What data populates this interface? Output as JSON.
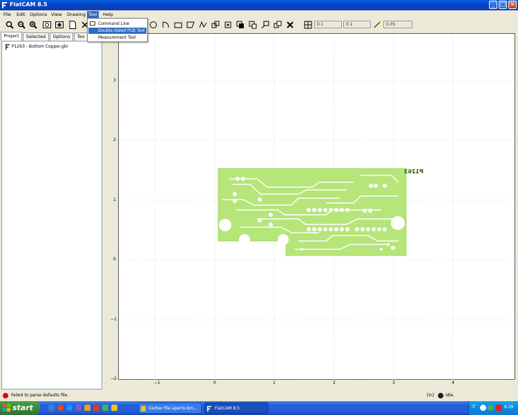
{
  "window": {
    "title": "FlatCAM 8.5"
  },
  "menubar": {
    "items": [
      "File",
      "Edit",
      "Options",
      "View",
      "Drawing",
      "Tool",
      "Help"
    ],
    "active": "Tool"
  },
  "dropdown": {
    "items": [
      "Command Line",
      "Double-Sided PCB Tool",
      "Measurement Tool"
    ],
    "highlighted": "Double-Sided PCB Tool"
  },
  "toolbar": {
    "fields": [
      "0.1",
      "0.1",
      "0.05"
    ]
  },
  "left_panel": {
    "tabs": [
      "Project",
      "Selected",
      "Options",
      "Too"
    ],
    "active_tab": "Project",
    "tree_items": [
      "P1263 - Bottom Copper.gbr"
    ]
  },
  "plot": {
    "x_ticks": [
      "−1",
      "0",
      "1",
      "2",
      "3",
      "4"
    ],
    "y_ticks": [
      "3",
      "2",
      "1",
      "0",
      "−1",
      "−2"
    ],
    "board_label": "P1263",
    "board_color": "#b6e57a"
  },
  "statusbar": {
    "message": "Failed to parse defaults file.",
    "units": "[in]",
    "state": "Idle."
  },
  "taskbar": {
    "start_label": "start",
    "tasks": [
      "Gerber file aperto.bm...",
      "FlatCAM 8.5"
    ],
    "tray_lang": "IT",
    "clock": "8.39"
  },
  "colors": {
    "titlebar": "#0546c8",
    "menu_highlight": "#316ac5",
    "taskbar": "#245edb",
    "start_button": "#37873a"
  }
}
